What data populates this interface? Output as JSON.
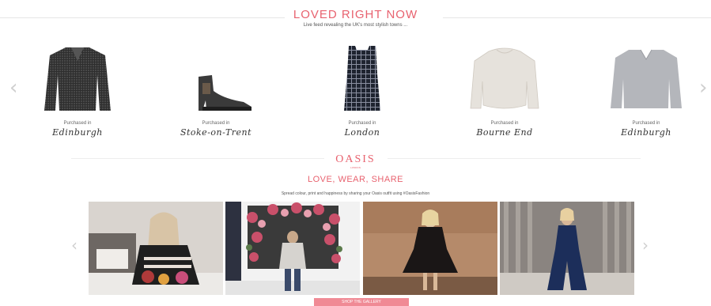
{
  "loved": {
    "title": "LOVED RIGHT NOW",
    "subtitle": "Live feed revealing the UK's most stylish towns ...",
    "products": [
      {
        "icon": "cardigan-image",
        "purchased_label": "Purchased in",
        "city": "Edinburgh"
      },
      {
        "icon": "ankle-boot-image",
        "purchased_label": "Purchased in",
        "city": "Stoke-on-Trent"
      },
      {
        "icon": "check-dress-image",
        "purchased_label": "Purchased in",
        "city": "London"
      },
      {
        "icon": "cream-jumper-image",
        "purchased_label": "Purchased in",
        "city": "Bourne End"
      },
      {
        "icon": "grey-jumper-image",
        "purchased_label": "Purchased in",
        "city": "Edinburgh"
      }
    ],
    "prev_icon": "chevron-left-icon",
    "next_icon": "chevron-right-icon"
  },
  "brand": {
    "name": "OASIS",
    "tagline": "LONDON"
  },
  "share": {
    "title": "LOVE, WEAR, SHARE",
    "subtitle": "Spread colour, print and happiness by sharing your Oasis outfit using #OasisFashion",
    "photos": [
      {
        "icon": "customer-photo-sofa"
      },
      {
        "icon": "customer-photo-flowers"
      },
      {
        "icon": "customer-photo-black-dress"
      },
      {
        "icon": "customer-photo-navy-jumpsuit"
      }
    ],
    "button_label": "SHOP THE GALLERY"
  },
  "colors": {
    "accent": "#e8626f",
    "button": "#f08a95"
  }
}
